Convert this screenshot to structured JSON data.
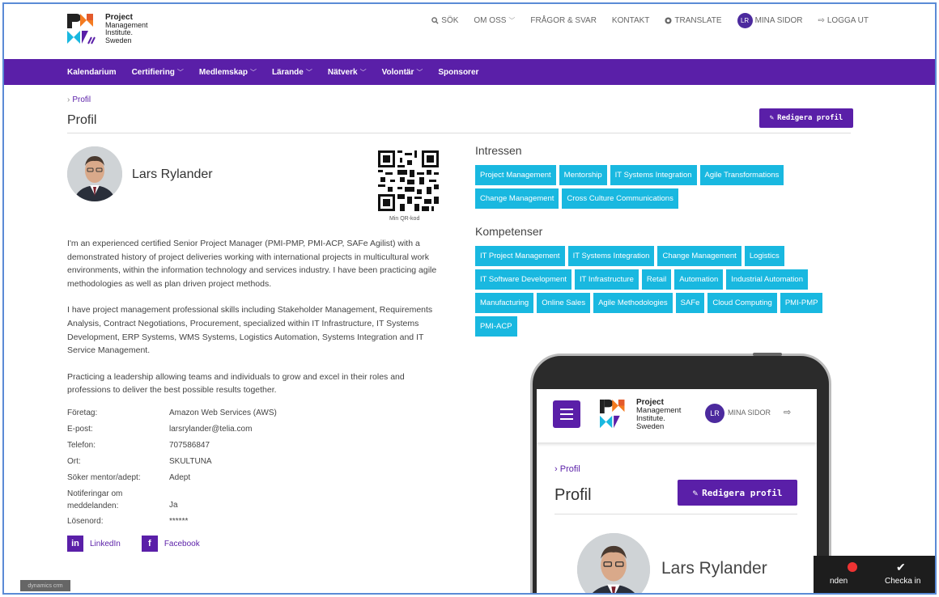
{
  "header": {
    "logo_lines": [
      "Project",
      "Management",
      "Institute.",
      "Sweden"
    ],
    "nav": [
      {
        "label": "SÖK",
        "icon": "search-icon"
      },
      {
        "label": "OM OSS",
        "icon": "chevron-down-icon"
      },
      {
        "label": "FRÅGOR & SVAR"
      },
      {
        "label": "KONTAKT"
      },
      {
        "label": "TRANSLATE",
        "icon": "globe-icon"
      },
      {
        "label": "MINA SIDOR",
        "avatar": "LR"
      },
      {
        "label": "LOGGA UT",
        "icon": "logout-icon"
      }
    ]
  },
  "mainnav": [
    "Kalendarium",
    "Certifiering",
    "Medlemskap",
    "Lärande",
    "Nätverk",
    "Volontär",
    "Sponsorer"
  ],
  "page": {
    "breadcrumb": "Profil",
    "title": "Profil",
    "edit_button": "Redigera profil"
  },
  "profile": {
    "name": "Lars Rylander",
    "qr_label": "Min QR-kod",
    "bio": [
      "I'm an experienced certified Senior Project Manager (PMI-PMP, PMI-ACP, SAFe Agilist) with a demonstrated history of project deliveries working with international projects in multicultural work environments, within the information technology and services industry. I have been practicing agile methodologies as well as plan driven project methods.",
      "I have project management professional skills including Stakeholder Management, Requirements Analysis, Contract Negotiations, Procurement, specialized within IT Infrastructure, IT Systems Development, ERP Systems, WMS Systems, Logistics Automation, Systems Integration and IT Service Management.",
      "Practicing a leadership allowing teams and individuals to grow and excel in their roles and professions to deliver the best possible results together."
    ],
    "details": [
      {
        "key": "Företag:",
        "value": "Amazon Web Services (AWS)"
      },
      {
        "key": "E-post:",
        "value": "larsrylander@telia.com"
      },
      {
        "key": "Telefon:",
        "value": "707586847"
      },
      {
        "key": "Ort:",
        "value": "SKULTUNA"
      },
      {
        "key": "Söker mentor/adept:",
        "value": "Adept"
      },
      {
        "key": "Notiferingar om meddelanden:",
        "value": "Ja"
      },
      {
        "key": "Lösenord:",
        "value": "******"
      }
    ],
    "social": [
      {
        "icon": "in",
        "label": "LinkedIn"
      },
      {
        "icon": "f",
        "label": "Facebook"
      }
    ]
  },
  "interests": {
    "title": "Intressen",
    "tags": [
      "Project Management",
      "Mentorship",
      "IT Systems Integration",
      "Agile Transformations",
      "Change Management",
      "Cross Culture Communications"
    ]
  },
  "competences": {
    "title": "Kompetenser",
    "tags": [
      "IT Project Management",
      "IT Systems Integration",
      "Change Management",
      "Logistics",
      "IT Software Development",
      "IT Infrastructure",
      "Retail",
      "Automation",
      "Industrial Automation",
      "Manufacturing",
      "Online Sales",
      "Agile Methodologies",
      "SAFe",
      "Cloud Computing",
      "PMI-PMP",
      "PMI-ACP"
    ]
  },
  "phone": {
    "mina": "MINA SIDOR",
    "avatar": "LR",
    "breadcrumb": "Profil",
    "title": "Profil",
    "edit_button": "Redigera profil",
    "name": "Lars Rylander"
  },
  "bottom_bar": {
    "left": "nden",
    "right": "Checka in"
  },
  "watermark": "dynamics crm",
  "colors": {
    "purple": "#5a1fa8",
    "tag": "#19b8e0"
  }
}
